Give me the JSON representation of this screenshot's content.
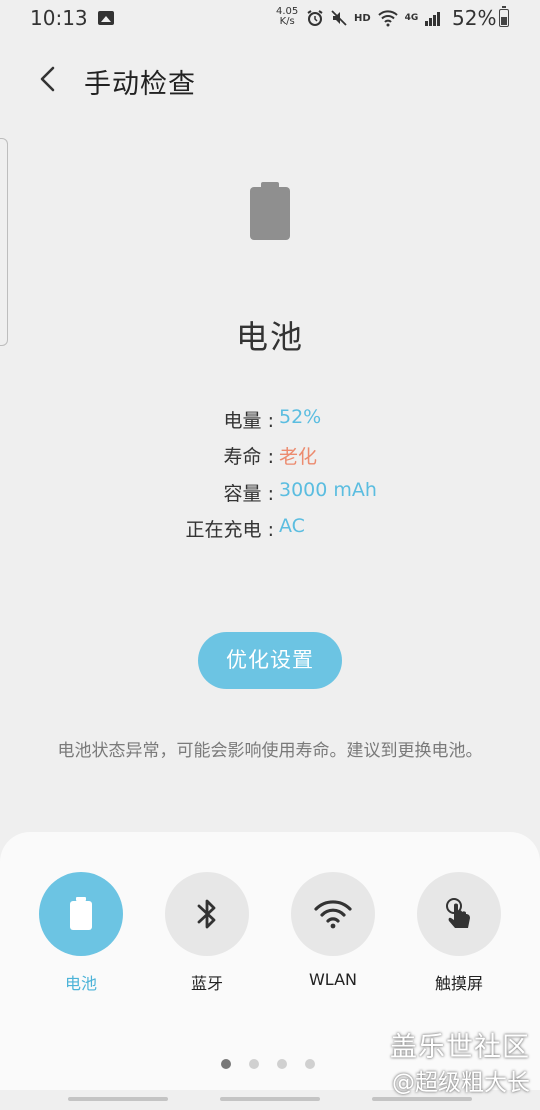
{
  "status_bar": {
    "time": "10:13",
    "net_speed_value": "4.05",
    "net_speed_unit": "K/s",
    "hd_label": "HD",
    "network_label": "4G",
    "battery_percent": "52%"
  },
  "header": {
    "title": "手动检查"
  },
  "battery": {
    "title": "电池",
    "rows": [
      {
        "label": "电量 :",
        "value": "52%",
        "color": "#5bbde0"
      },
      {
        "label": "寿命 :",
        "value": "老化",
        "color": "#ec8b6f"
      },
      {
        "label": "容量 :",
        "value": "3000 mAh",
        "color": "#5bbde0"
      },
      {
        "label": "正在充电 :",
        "value": "AC",
        "color": "#5bbde0"
      }
    ],
    "optimize_label": "优化设置",
    "notice": "电池状态异常，可能会影响使用寿命。建议到更换电池。"
  },
  "tiles": [
    {
      "label": "电池",
      "icon": "battery-icon",
      "active": true
    },
    {
      "label": "蓝牙",
      "icon": "bluetooth-icon",
      "active": false
    },
    {
      "label": "WLAN",
      "icon": "wifi-icon",
      "active": false
    },
    {
      "label": "触摸屏",
      "icon": "touch-icon",
      "active": false
    }
  ],
  "pagination": {
    "total": 4,
    "current": 1
  },
  "watermark": {
    "line1": "盖乐世社区",
    "line2": "@超级粗大长"
  },
  "colors": {
    "accent": "#6cc4e3",
    "warning": "#ec8b6f"
  }
}
